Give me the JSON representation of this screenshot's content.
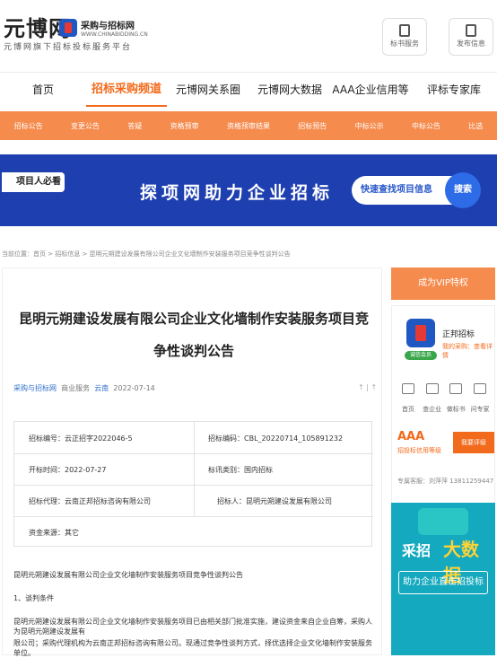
{
  "header": {
    "logo_text": "元博网",
    "logo_sub": "元博网旗下招标投标服务平台",
    "partner_title": "采购与招标网",
    "partner_url": "WWW.CHINABIDDING.CN",
    "buttons": [
      {
        "label": "标书服务",
        "icon": "document-icon"
      },
      {
        "label": "发布信息",
        "icon": "edit-icon"
      }
    ]
  },
  "nav": [
    {
      "label": "首页",
      "active": false
    },
    {
      "label": "招标采购频道",
      "active": true
    },
    {
      "label": "元博网关系圈",
      "active": false
    },
    {
      "label": "元博网大数据",
      "active": false
    },
    {
      "label": "AAA企业信用等级",
      "active": false
    },
    {
      "label": "评标专家库",
      "active": false
    }
  ],
  "subnav": [
    "招标公告",
    "变更公告",
    "答疑",
    "资格预审",
    "资格预审结果",
    "招标预告",
    "中标公示",
    "中标公告",
    "比选"
  ],
  "banner": {
    "tag": "项目人必看",
    "slogan": "探项网助力企业招标",
    "pill": "快速查找项目信息",
    "search_btn": "搜索"
  },
  "breadcrumb": "当前位置：首页 > 招标信息 > 昆明元朔建设发展有限公司企业文化墙制作安装服务项目竞争性谈判公告",
  "article": {
    "title": "昆明元朔建设发展有限公司企业文化墙制作安装服务项目竞争性谈判公告",
    "source": "采购与招标网",
    "category": "商业服务",
    "region": "云南",
    "date": "2022-07-14",
    "font_ctrl": "↑ | ↑",
    "info": {
      "bid_no": "招标编号：云正招字2022046-5",
      "code": "招标编码：CBL_20220714_105891232",
      "open_time": "开标时间：2022-07-27",
      "bid_type": "标讯类别：国内招标",
      "agent": "招标代理：云南正邦招标咨询有限公司",
      "tenderer": "招标人：昆明元朔建设发展有限公司",
      "fund": "资金来源：其它"
    },
    "body": [
      "昆明元朔建设发展有限公司企业文化墙制作安装服务项目竞争性谈判公告",
      "1、谈判条件",
      "昆明元朔建设发展有限公司企业文化墙制作安装服务项目已由相关部门批准实施，建设资金来自企业自筹，采购人为昆明元朔建设发展有",
      "限公司；采购代理机构为云南正邦招标咨询有限公司。现通过竞争性谈判方式，择优选择企业文化墙制作安装服务单位。"
    ]
  },
  "sidebar": {
    "vip": "成为VIP特权",
    "company": "正邦招标",
    "links": "我的采购：查看详情",
    "badge": "诚信会员",
    "icons": [
      {
        "label": "首页",
        "icon": "home-icon"
      },
      {
        "label": "查企业",
        "icon": "eye-icon"
      },
      {
        "label": "做标书",
        "icon": "file-icon"
      },
      {
        "label": "问专家",
        "icon": "rss-icon"
      }
    ],
    "aaa": "AAA",
    "aaa_sub": "招投标信用等级",
    "rate_btn": "我要评级",
    "service": "专属客服：刘萍萍 13811259447",
    "ad": {
      "t1": "采招",
      "t2": "大数据",
      "t3": "助力企业直击招投标"
    }
  }
}
